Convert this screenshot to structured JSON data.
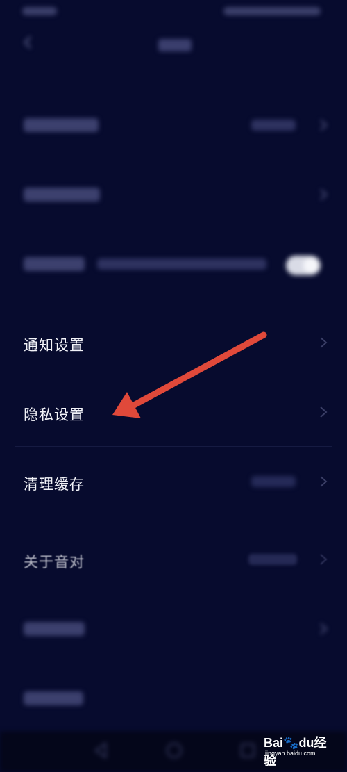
{
  "settings": {
    "items": [
      {
        "label": "通知设置"
      },
      {
        "label": "隐私设置"
      },
      {
        "label": "清理缓存"
      },
      {
        "label": "关于音对"
      }
    ]
  },
  "watermark": {
    "brand": "Bai",
    "brand_mid": "du",
    "brand_suffix": "经验",
    "domain": "jingyan.baidu.com"
  },
  "colors": {
    "background": "#070b2e",
    "annotation_arrow": "#e0493a"
  }
}
